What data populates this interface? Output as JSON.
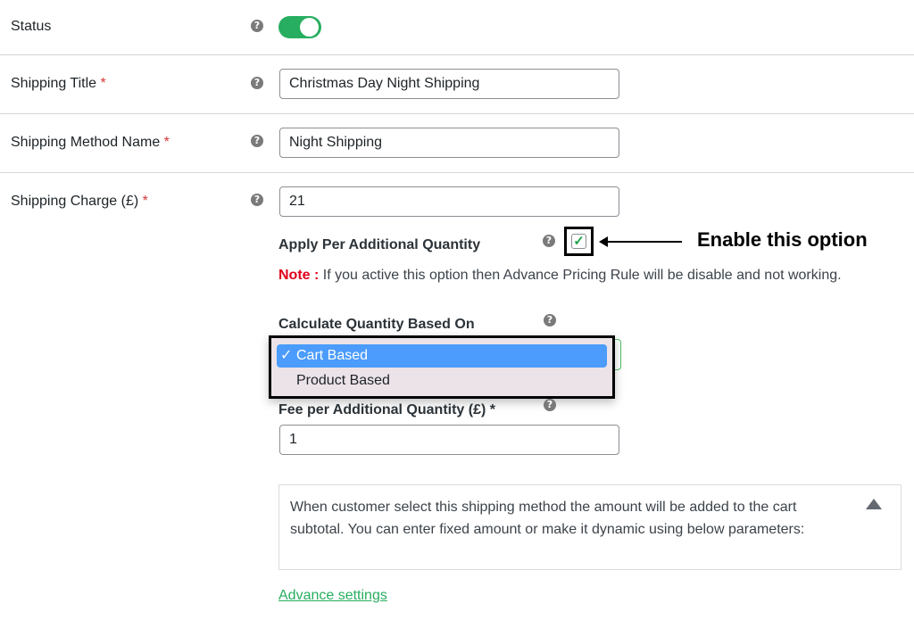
{
  "rows": [
    {
      "label": "Status",
      "required": false
    },
    {
      "label": "Shipping Title",
      "required": true
    },
    {
      "label": "Shipping Method Name",
      "required": true
    },
    {
      "label": "Shipping Charge (£)",
      "required": true
    }
  ],
  "required_mark": "*",
  "help_icon_glyph": "?",
  "status": {
    "enabled": true,
    "accent_color": "#27ae60"
  },
  "shipping_title": {
    "value": "Christmas Day Night Shipping"
  },
  "shipping_method_name": {
    "value": "Night Shipping"
  },
  "shipping_charge": {
    "value": "21"
  },
  "apply_per_additional_quantity": {
    "label": "Apply Per Additional Quantity",
    "checked": true,
    "check_glyph": "✓"
  },
  "annotation": {
    "text": "Enable this option"
  },
  "note": {
    "key": "Note :",
    "text": " If you active this option then Advance Pricing Rule will be disable and not working."
  },
  "calculate_quantity": {
    "label": "Calculate Quantity Based On",
    "selected": "Cart Based",
    "options": [
      {
        "label": "Cart Based",
        "selected": true,
        "mark": "✓"
      },
      {
        "label": "Product Based",
        "selected": false,
        "mark": ""
      }
    ]
  },
  "fee_per_additional_quantity": {
    "label": "Fee per Additional Quantity (£) *",
    "value": "1"
  },
  "info_box": {
    "text": "When customer select this shipping method the amount will be added to the cart subtotal. You can enter fixed amount or make it dynamic using below parameters:"
  },
  "advance_settings_link": "Advance settings"
}
